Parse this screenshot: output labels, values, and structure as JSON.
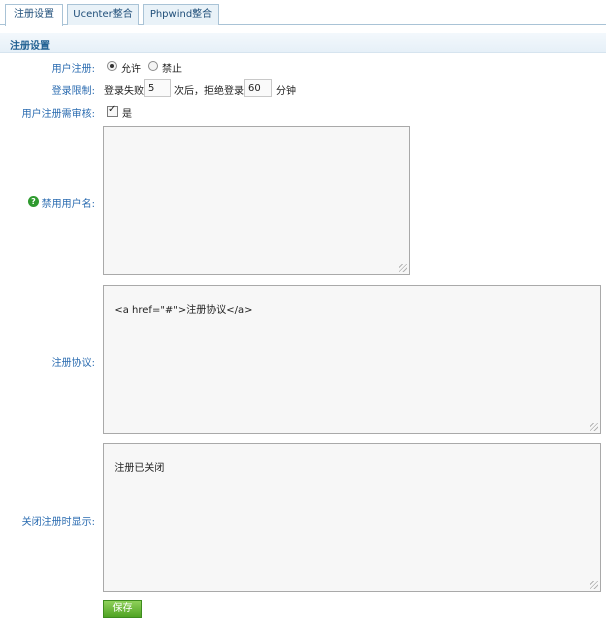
{
  "tabs": [
    {
      "label": "注册设置",
      "active": true
    },
    {
      "label": "Ucenter整合",
      "active": false
    },
    {
      "label": "Phpwind整合",
      "active": false
    }
  ],
  "section": {
    "title": "注册设置"
  },
  "user_register": {
    "label": "用户注册:",
    "options": [
      {
        "label": "允许",
        "selected": true
      },
      {
        "label": "禁止",
        "selected": false
      }
    ]
  },
  "login_limit": {
    "label": "登录限制:",
    "prefix": "登录失败",
    "attempts": "5",
    "middle": "次后，拒绝登录",
    "minutes": "60",
    "suffix": "分钟"
  },
  "review": {
    "label": "用户注册需审核:",
    "checked": true,
    "option_label": "是"
  },
  "banned_usernames": {
    "label": "禁用用户名:",
    "value": "",
    "help_icon": "question-circle-icon"
  },
  "agreement": {
    "label": "注册协议:",
    "value": "<a href=\"#\">注册协议</a>"
  },
  "closed_message": {
    "label": "关闭注册时显示:",
    "value": "注册已关闭"
  },
  "save_button": {
    "label": "保存"
  },
  "colors": {
    "accent": "#2a6bb0",
    "save": "#4fa323",
    "help": "#2f9a2f"
  }
}
